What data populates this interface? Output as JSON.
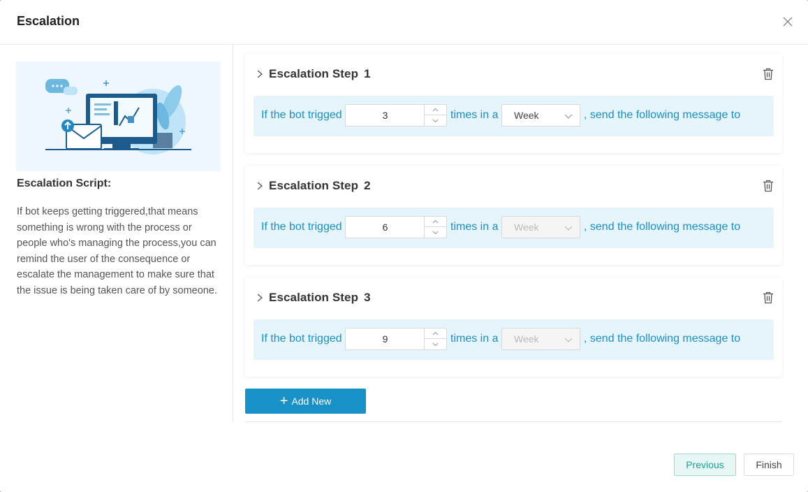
{
  "modal": {
    "title": "Escalation"
  },
  "left": {
    "script_title": "Escalation Script:",
    "script_text": "If bot keeps getting triggered,that means something is wrong with the process or people who's managing the process,you can remind the user of the consequence or escalate the management to make sure that the issue is being taken care of by someone."
  },
  "steps": [
    {
      "title": "Escalation Step",
      "number": "1",
      "prefix": "If the bot trigged",
      "count": "3",
      "middle": "times in a",
      "period": "Week",
      "period_disabled": false,
      "suffix": ", send the following message to"
    },
    {
      "title": "Escalation Step",
      "number": "2",
      "prefix": "If the bot trigged",
      "count": "6",
      "middle": "times in a",
      "period": "Week",
      "period_disabled": true,
      "suffix": ", send the following message to"
    },
    {
      "title": "Escalation Step",
      "number": "3",
      "prefix": "If the bot trigged",
      "count": "9",
      "middle": "times in a",
      "period": "Week",
      "period_disabled": true,
      "suffix": ", send the following message to"
    }
  ],
  "actions": {
    "add_new": "Add New",
    "add_icon": "plus-icon",
    "previous": "Previous",
    "finish": "Finish"
  },
  "colors": {
    "accent": "#1890c8",
    "row_bg": "#e6f5fc",
    "row_text": "#1a8fc4",
    "prev_text": "#1aa391"
  },
  "icons": {
    "close": "close-icon",
    "expand": "chevron-right-icon",
    "delete": "trash-icon",
    "spinner_up": "chevron-up-icon",
    "spinner_down": "chevron-down-icon",
    "select": "chevron-down-icon"
  }
}
